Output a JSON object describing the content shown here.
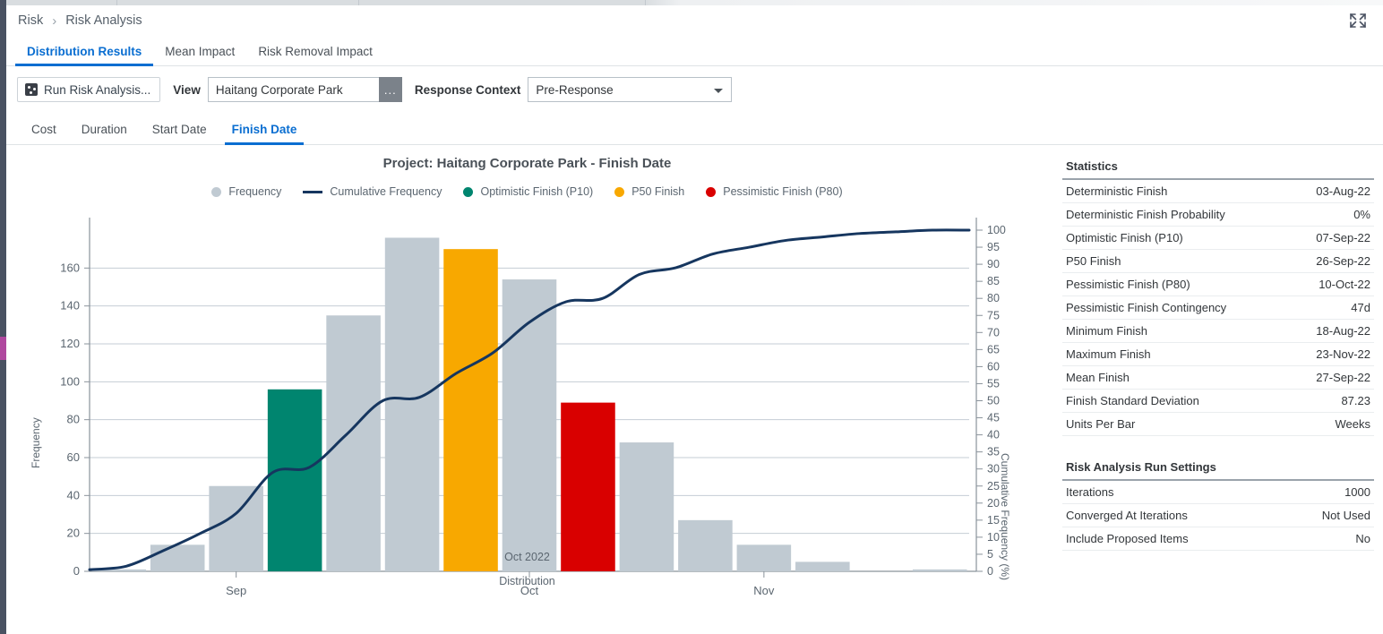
{
  "window": {
    "expand_icon": "expand-fullscreen-icon"
  },
  "breadcrumb": {
    "root": "Risk",
    "separator": "›",
    "current": "Risk Analysis"
  },
  "primary_tabs": [
    {
      "label": "Distribution Results",
      "active": true
    },
    {
      "label": "Mean Impact",
      "active": false
    },
    {
      "label": "Risk Removal Impact",
      "active": false
    }
  ],
  "toolbar": {
    "run_button": "Run Risk Analysis...",
    "run_button_icon": "dice-icon",
    "view_label": "View",
    "view_value": "Haitang Corporate Park",
    "view_browse_button": "...",
    "response_context_label": "Response Context",
    "response_context_value": "Pre-Response",
    "response_context_options": [
      "Pre-Response"
    ],
    "dropdown_icon": "chevron-down-icon"
  },
  "secondary_tabs": [
    {
      "label": "Cost",
      "active": false
    },
    {
      "label": "Duration",
      "active": false
    },
    {
      "label": "Start Date",
      "active": false
    },
    {
      "label": "Finish Date",
      "active": true
    }
  ],
  "colors": {
    "accent": "#0a6ed1",
    "bar": "#c0cad2",
    "line": "#16365f",
    "optimistic": "#00856f",
    "p50": "#f8a800",
    "pessimistic": "#d90000",
    "rail": "#4a5262",
    "rail_accent": "#b0489f"
  },
  "chart_data": {
    "type": "bar",
    "title": "Project: Haitang Corporate Park - Finish Date",
    "xlabel": "Distribution",
    "xsublabel": "Oct 2022",
    "ylabel": "Frequency",
    "y2label": "Cumulative Frequency (%)",
    "grid": true,
    "legend_position": "top",
    "legend": [
      {
        "name": "Frequency",
        "marker": "dot",
        "color": "#c0cad2"
      },
      {
        "name": "Cumulative Frequency",
        "marker": "line",
        "color": "#16365f"
      },
      {
        "name": "Optimistic Finish (P10)",
        "marker": "dot",
        "color": "#00856f"
      },
      {
        "name": "P50 Finish",
        "marker": "dot",
        "color": "#f8a800"
      },
      {
        "name": "Pessimistic Finish (P80)",
        "marker": "dot",
        "color": "#d90000"
      }
    ],
    "ylim": [
      0,
      180
    ],
    "yticks": [
      0,
      20,
      40,
      60,
      80,
      100,
      120,
      140,
      160
    ],
    "y2lim": [
      0,
      100
    ],
    "y2ticks": [
      0,
      5,
      10,
      15,
      20,
      25,
      30,
      35,
      40,
      45,
      50,
      55,
      60,
      65,
      70,
      75,
      80,
      85,
      90,
      95,
      100
    ],
    "xticks": [
      {
        "label": "Sep",
        "bar_index": 2
      },
      {
        "label": "Oct",
        "bar_index": 7
      },
      {
        "label": "Nov",
        "bar_index": 11
      }
    ],
    "categories": [
      "b1",
      "b2",
      "b3",
      "b4",
      "b5",
      "b6",
      "b7",
      "b8",
      "b9",
      "b10",
      "b11",
      "b12",
      "b13",
      "b14",
      "b15"
    ],
    "values": [
      1,
      14,
      45,
      96,
      135,
      176,
      170,
      154,
      89,
      68,
      27,
      14,
      5,
      0,
      1
    ],
    "bar_colors": [
      "#c0cad2",
      "#c0cad2",
      "#c0cad2",
      "#00856f",
      "#c0cad2",
      "#c0cad2",
      "#f8a800",
      "#c0cad2",
      "#d90000",
      "#c0cad2",
      "#c0cad2",
      "#c0cad2",
      "#c0cad2",
      "#c0cad2",
      "#c0cad2"
    ],
    "cumulative_series": {
      "name": "Cumulative Frequency",
      "color": "#16365f",
      "values": [
        0.5,
        1.5,
        6,
        11,
        17,
        29,
        30.5,
        40,
        50,
        51,
        58,
        64,
        73,
        79,
        80,
        87,
        89,
        93,
        95,
        97,
        98,
        99,
        99.5,
        100,
        100
      ]
    }
  },
  "statistics": {
    "heading": "Statistics",
    "rows": [
      {
        "key": "Deterministic Finish",
        "value": "03-Aug-22"
      },
      {
        "key": "Deterministic Finish Probability",
        "value": "0%"
      },
      {
        "key": "Optimistic Finish (P10)",
        "value": "07-Sep-22"
      },
      {
        "key": "P50 Finish",
        "value": "26-Sep-22"
      },
      {
        "key": "Pessimistic Finish (P80)",
        "value": "10-Oct-22"
      },
      {
        "key": "Pessimistic Finish Contingency",
        "value": "47d"
      },
      {
        "key": "Minimum Finish",
        "value": "18-Aug-22"
      },
      {
        "key": "Maximum Finish",
        "value": "23-Nov-22"
      },
      {
        "key": "Mean Finish",
        "value": "27-Sep-22"
      },
      {
        "key": "Finish Standard Deviation",
        "value": "87.23"
      },
      {
        "key": "Units Per Bar",
        "value": "Weeks"
      }
    ]
  },
  "run_settings": {
    "heading": "Risk Analysis Run Settings",
    "rows": [
      {
        "key": "Iterations",
        "value": "1000"
      },
      {
        "key": "Converged At Iterations",
        "value": "Not Used"
      },
      {
        "key": "Include Proposed Items",
        "value": "No"
      }
    ]
  }
}
